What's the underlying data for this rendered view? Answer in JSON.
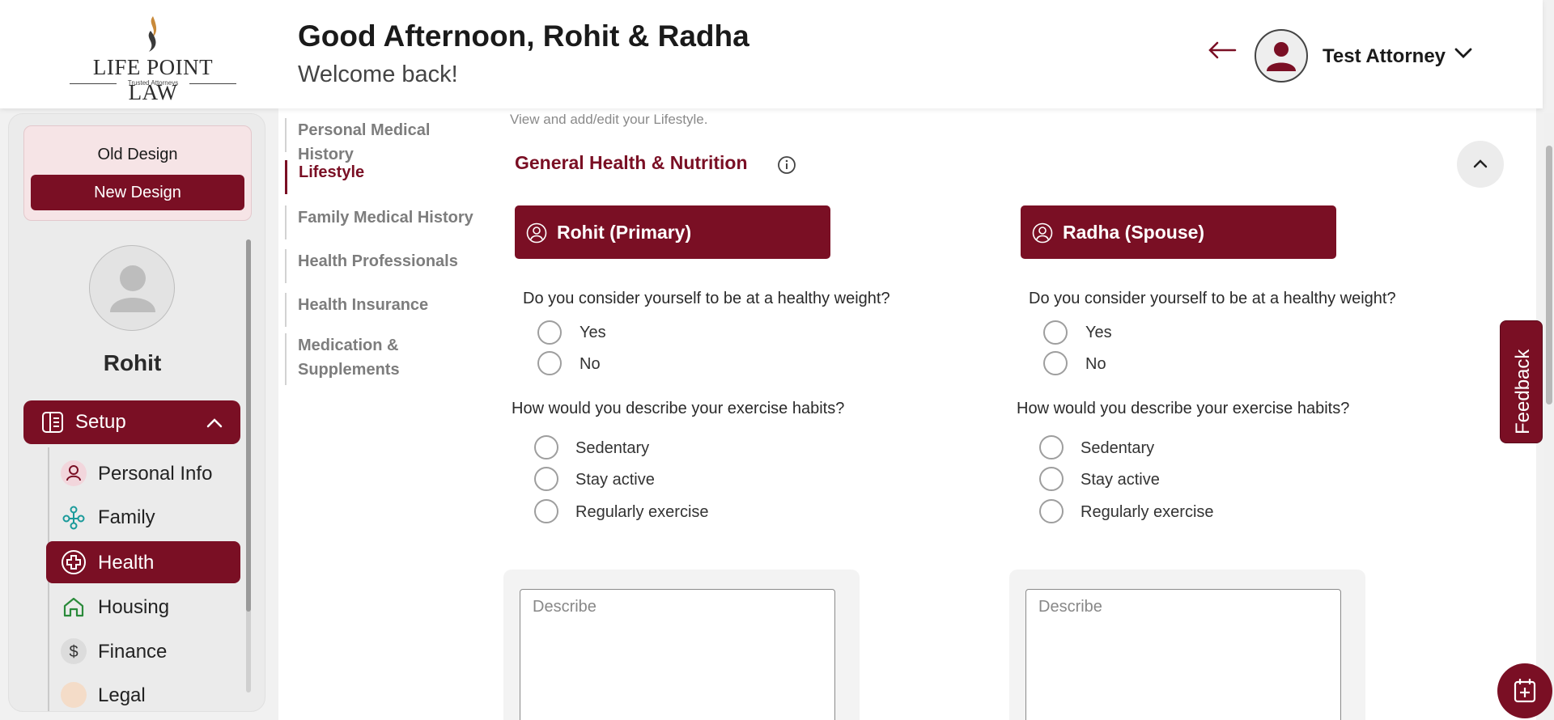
{
  "header": {
    "logo_text": "LIFE POINT LAW",
    "logo_tagline": "Trusted Attorneys",
    "greeting": "Good Afternoon, Rohit & Radha",
    "welcome": "Welcome back!",
    "user_name": "Test Attorney"
  },
  "sidebar": {
    "old_design": "Old Design",
    "new_design": "New Design",
    "profile_name": "Rohit",
    "setup_label": "Setup",
    "items": [
      {
        "label": "Personal Info",
        "icon": "person-icon"
      },
      {
        "label": "Family",
        "icon": "family-tree-icon"
      },
      {
        "label": "Health",
        "icon": "health-cross-icon",
        "active": true
      },
      {
        "label": "Housing",
        "icon": "house-icon"
      },
      {
        "label": "Finance",
        "icon": "dollar-icon"
      },
      {
        "label": "Legal",
        "icon": "legal-icon"
      }
    ]
  },
  "subnav": {
    "items": [
      "Personal Medical History",
      "Lifestyle",
      "Family Medical History",
      "Health Professionals",
      "Health Insurance",
      "Medication & Supplements"
    ],
    "active": "Lifestyle"
  },
  "main": {
    "hint": "View and add/edit your Lifestyle.",
    "section_title": "General Health & Nutrition",
    "persons": [
      {
        "label": "Rohit (Primary)",
        "q_weight": "Do you consider yourself to be at a healthy weight?",
        "weight_options": [
          "Yes",
          "No"
        ],
        "q_exercise": "How would you describe your exercise habits?",
        "exercise_options": [
          "Sedentary",
          "Stay active",
          "Regularly exercise"
        ],
        "describe_placeholder": "Describe"
      },
      {
        "label": "Radha (Spouse)",
        "q_weight": "Do you consider yourself to be at a healthy weight?",
        "weight_options": [
          "Yes",
          "No"
        ],
        "q_exercise": "How would you describe your exercise habits?",
        "exercise_options": [
          "Sedentary",
          "Stay active",
          "Regularly exercise"
        ],
        "describe_placeholder": "Describe"
      }
    ]
  },
  "feedback_label": "Feedback",
  "colors": {
    "accent": "#7a0f24",
    "background": "#f1f1f1"
  }
}
